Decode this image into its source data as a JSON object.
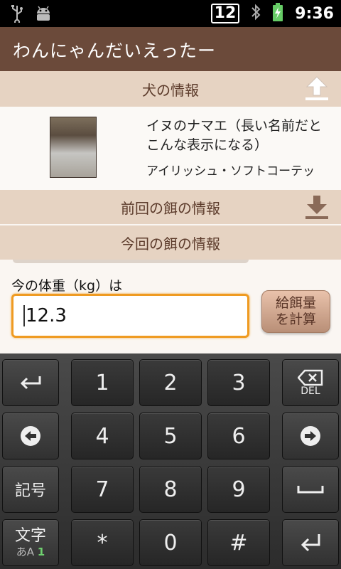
{
  "status_bar": {
    "notification_count": "12",
    "time": "9:36",
    "icons": [
      "usb-icon",
      "android-debug-icon",
      "bluetooth-icon",
      "battery-charging-icon"
    ]
  },
  "app": {
    "title": "わんにゃんだいえったー"
  },
  "sections": {
    "dog_info": "犬の情報",
    "previous_feed": "前回の餌の情報",
    "current_feed": "今回の餌の情報"
  },
  "dog": {
    "name": "イヌのナマエ（長い名前だとこんな表示になる）",
    "breed": "アイリッシュ・ソフトコーテッ"
  },
  "form": {
    "weight_label": "今の体重（kg）は",
    "weight_value": "12.3",
    "calc_button_line1": "給餌量",
    "calc_button_line2": "を計算"
  },
  "keyboard": {
    "row1": [
      "↩",
      "1",
      "2",
      "3",
      "DEL"
    ],
    "row2": [
      "←",
      "4",
      "5",
      "6",
      "→"
    ],
    "row3": [
      "記号",
      "7",
      "8",
      "9",
      "space"
    ],
    "row4_mode": "文字",
    "row4_mode_sub": "あA",
    "row4_mode_sub_num": "1",
    "row4": [
      "*",
      "0",
      "#"
    ]
  },
  "colors": {
    "appbar": "#6b4a3a",
    "section_header": "#e6d3c2",
    "input_focus": "#ef9b22"
  }
}
